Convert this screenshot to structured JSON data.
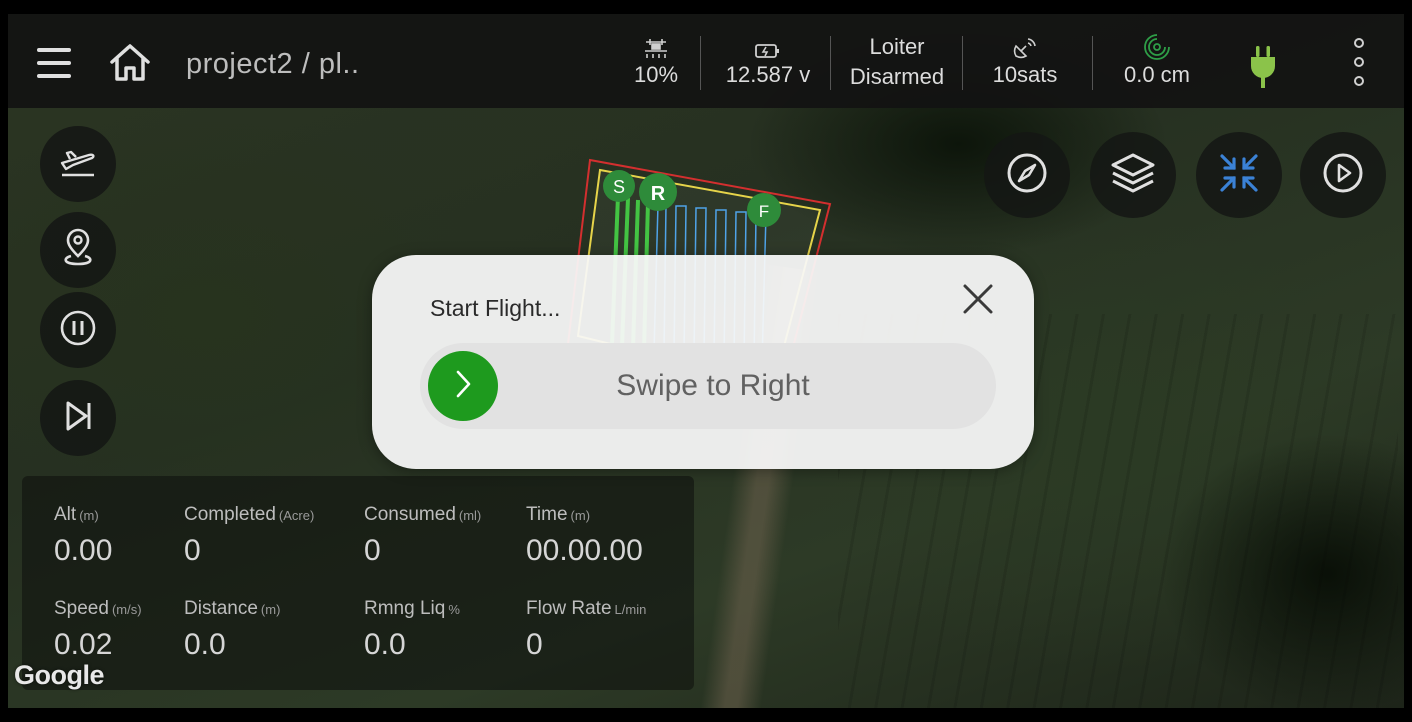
{
  "header": {
    "title": "project2 / pl..",
    "spray_percent": "10%",
    "battery_voltage": "12.587 v",
    "flight_mode": "Loiter",
    "arm_state": "Disarmed",
    "satellites": "10sats",
    "rtk_accuracy": "0.0 cm",
    "icons": {
      "menu": "menu-icon",
      "home": "home-icon",
      "sprayer": "sprayer-icon",
      "battery": "battery-icon",
      "gps": "satellite-icon",
      "rtk": "rtk-signal-icon",
      "plug": "plug-icon",
      "more": "more-vertical-icon"
    },
    "colors": {
      "plug": "#8bc34a",
      "rtk": "#2e9e47"
    }
  },
  "left_controls": [
    {
      "name": "takeoff-button",
      "icon": "takeoff-icon"
    },
    {
      "name": "location-button",
      "icon": "map-pin-icon"
    },
    {
      "name": "pause-button",
      "icon": "pause-icon"
    },
    {
      "name": "skip-button",
      "icon": "skip-next-icon"
    }
  ],
  "right_controls": [
    {
      "name": "compass-button",
      "icon": "compass-icon"
    },
    {
      "name": "layers-button",
      "icon": "layers-icon"
    },
    {
      "name": "collapse-button",
      "icon": "collapse-arrows-icon"
    },
    {
      "name": "play-button",
      "icon": "play-icon"
    }
  ],
  "map": {
    "markers": {
      "start": "S",
      "rtl": "R",
      "finish": "F"
    },
    "attribution": "Google",
    "colors": {
      "boundary": "#d32f2f",
      "mission_edge": "#e6d44a",
      "sprayed": "#43c443",
      "planned": "#4fa3e8",
      "marker": "#2e8b3a"
    }
  },
  "telemetry": {
    "row1": [
      {
        "label": "Alt",
        "unit": "(m)",
        "value": "0.00"
      },
      {
        "label": "Completed",
        "unit": "(Acre)",
        "value": "0"
      },
      {
        "label": "Consumed",
        "unit": "(ml)",
        "value": "0"
      },
      {
        "label": "Time",
        "unit": "(m)",
        "value": "00.00.00"
      }
    ],
    "row2": [
      {
        "label": "Speed",
        "unit": "(m/s)",
        "value": "0.02"
      },
      {
        "label": "Distance",
        "unit": "(m)",
        "value": "0.0"
      },
      {
        "label": "Rmng Liq",
        "unit": "%",
        "value": "0.0"
      },
      {
        "label": "Flow Rate",
        "unit": "L/min",
        "value": "0"
      }
    ]
  },
  "dialog": {
    "title": "Start Flight...",
    "swipe_label": "Swipe to Right",
    "knob_color": "#1e9a1e",
    "icons": {
      "close": "close-icon",
      "knob": "chevron-right-icon"
    }
  }
}
